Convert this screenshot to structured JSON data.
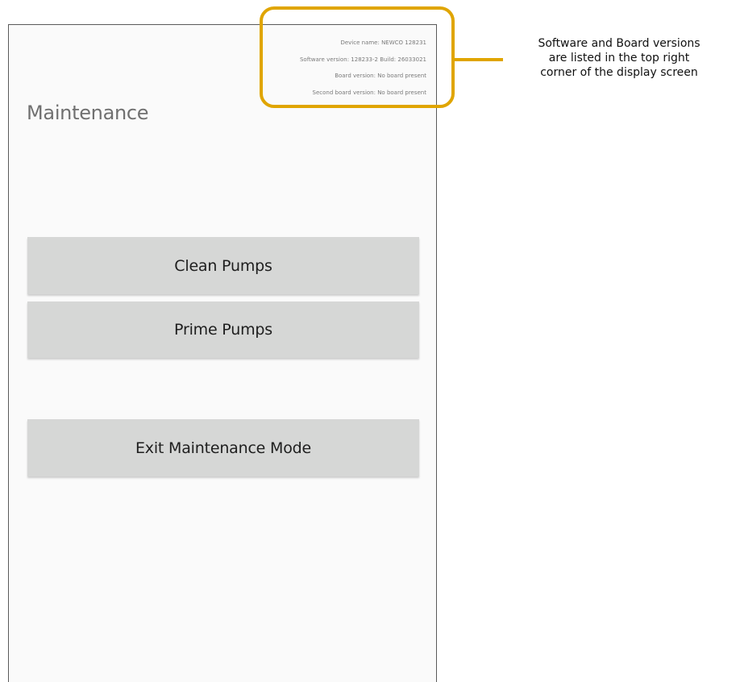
{
  "device_info": {
    "device_name": "Device name: NEWCO 128231",
    "software_version": "Software version: 128233-2 Build: 26033021",
    "board_version": "Board version: No board present",
    "second_board_version": "Second board version: No board present"
  },
  "page": {
    "title": "Maintenance"
  },
  "buttons": {
    "clean_pumps": "Clean Pumps",
    "prime_pumps": "Prime Pumps",
    "exit_maintenance": "Exit Maintenance Mode"
  },
  "callout": {
    "lines": [
      "Software and Board versions",
      "are listed in the top right",
      "corner of the display screen"
    ]
  },
  "colors": {
    "callout_accent": "#e0a500",
    "button_bg": "#d6d7d6",
    "screen_bg": "#fafafa"
  }
}
